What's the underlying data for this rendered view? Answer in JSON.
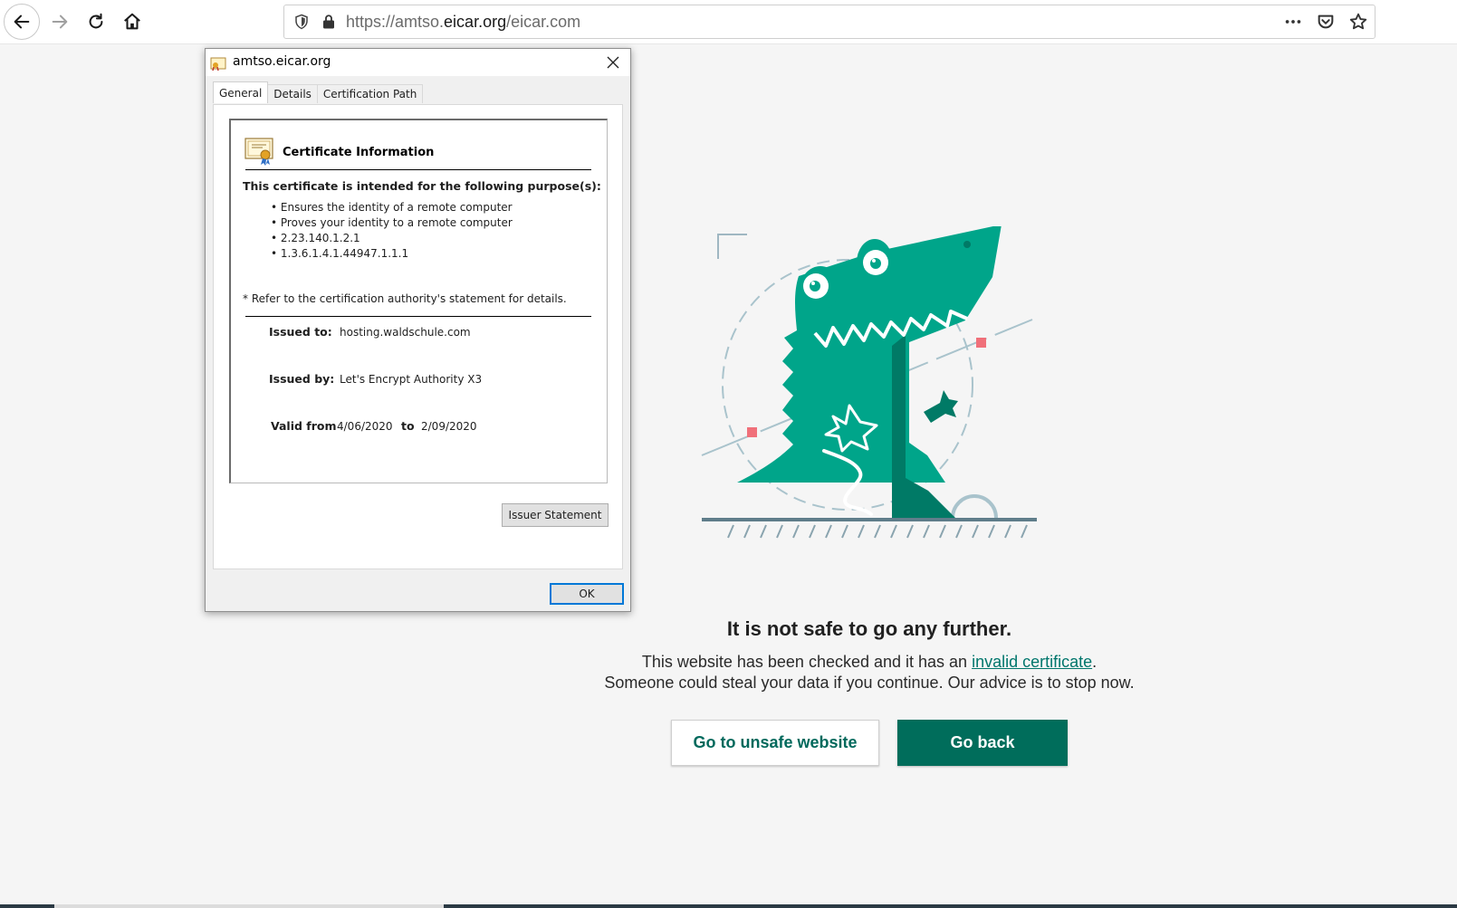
{
  "browser": {
    "url_prefix": "https://amtso.",
    "url_domain": "eicar.org",
    "url_suffix": "/eicar.com"
  },
  "dialog": {
    "title": "amtso.eicar.org",
    "tabs": [
      {
        "label": "General",
        "active": true
      },
      {
        "label": "Details",
        "active": false
      },
      {
        "label": "Certification Path",
        "active": false
      }
    ],
    "heading": "Certificate Information",
    "purpose_heading": "This certificate is intended for the following purpose(s):",
    "purposes": [
      "Ensures the identity of a remote computer",
      "Proves your identity to a remote computer",
      "2.23.140.1.2.1",
      "1.3.6.1.4.1.44947.1.1.1"
    ],
    "refer_note": "* Refer to the certification authority's statement for details.",
    "issued_to_label": "Issued to:",
    "issued_to": "hosting.waldschule.com",
    "issued_by_label": "Issued by:",
    "issued_by": "Let's Encrypt Authority X3",
    "valid_from_label": "Valid from",
    "valid_from": "4/06/2020",
    "to_label": "to",
    "valid_to": "2/09/2020",
    "issuer_statement_label": "Issuer Statement",
    "ok_label": "OK"
  },
  "warning": {
    "title": "It is not safe to go any further.",
    "text_before_link": "This website has been checked and it has an ",
    "link_text": "invalid certificate",
    "text_after_link": ".",
    "line2": "Someone could steal your data if you continue. Our advice is to stop now.",
    "unsafe_button": "Go to unsafe website",
    "back_button": "Go back"
  },
  "colors": {
    "accent": "#006d5b",
    "croc": "#00a58a",
    "croc_dark": "#007a66",
    "marker": "#f0707a"
  }
}
